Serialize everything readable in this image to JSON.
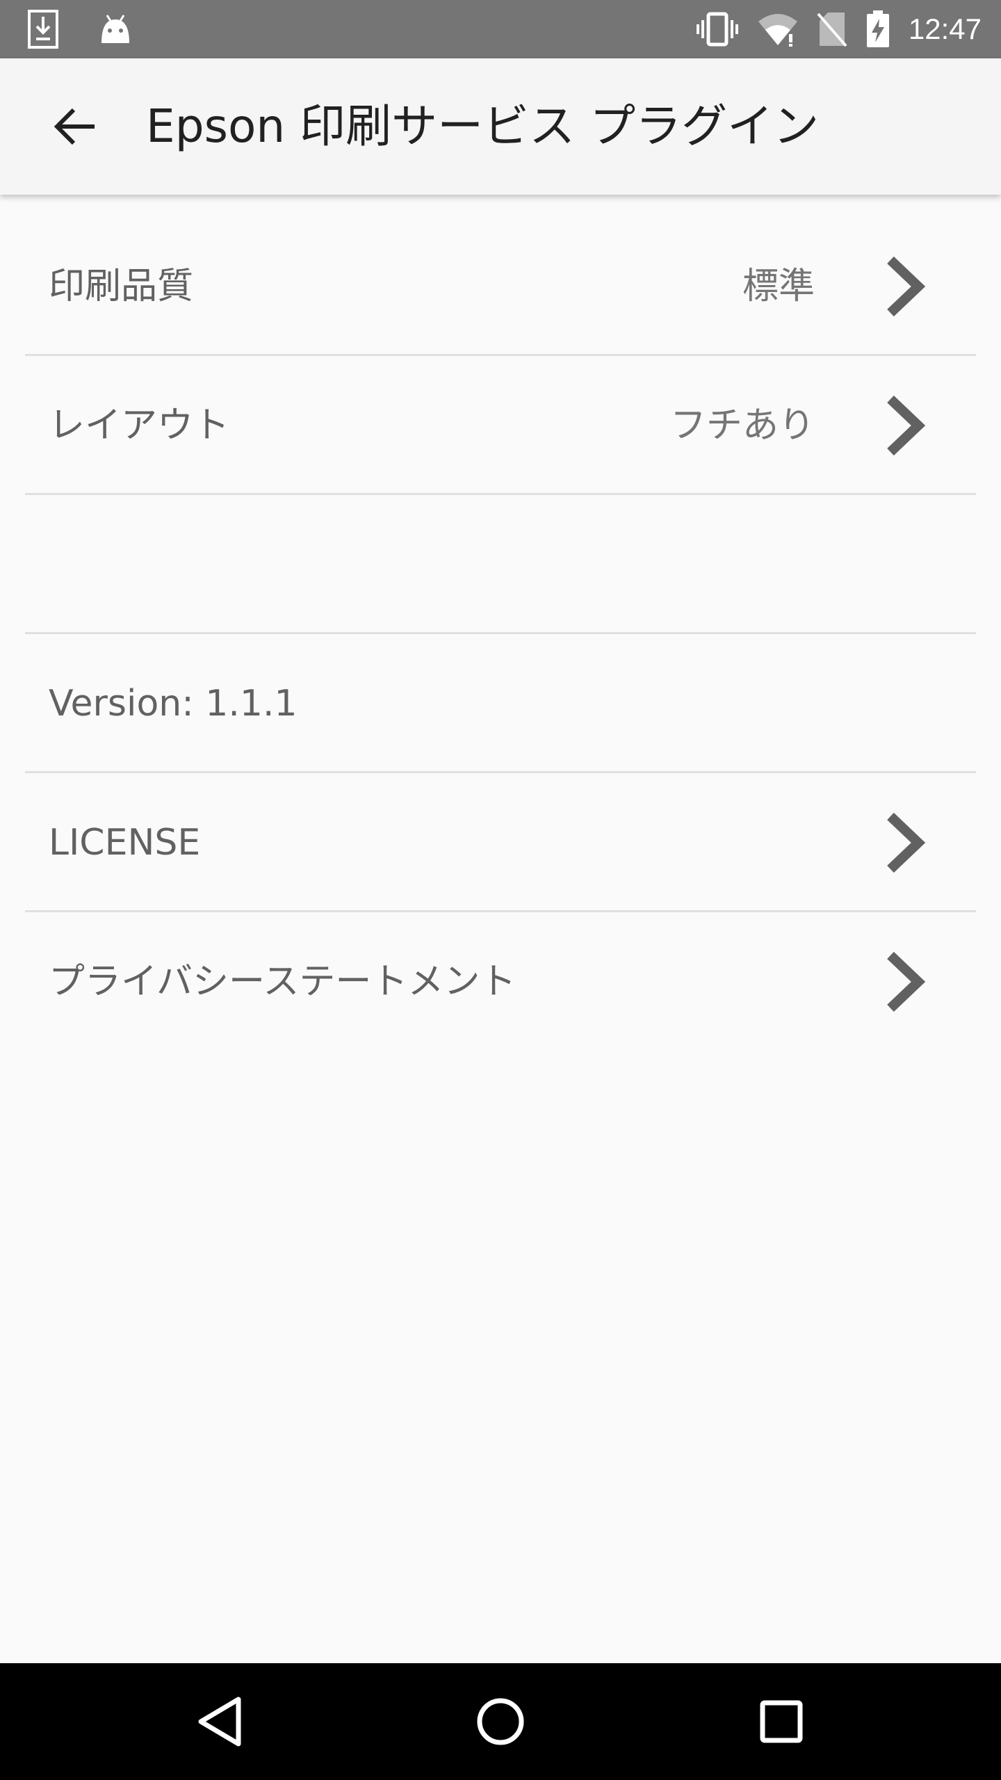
{
  "status_bar": {
    "time": "12:47",
    "icons": [
      "download-icon",
      "android-icon",
      "vibrate-icon",
      "wifi-icon",
      "no-sim-icon",
      "battery-charging-icon"
    ]
  },
  "app_bar": {
    "title": "Epson 印刷サービス プラグイン",
    "back_icon": "arrow-back-icon"
  },
  "settings": {
    "rows": [
      {
        "label": "印刷品質",
        "value": "標準",
        "chevron": true
      },
      {
        "label": "レイアウト",
        "value": "フチあり",
        "chevron": true
      },
      {
        "label": "",
        "value": "",
        "chevron": false
      },
      {
        "label": "Version: 1.1.1",
        "value": "",
        "chevron": false
      },
      {
        "label": "LICENSE",
        "value": "",
        "chevron": true
      },
      {
        "label": "プライバシーステートメント",
        "value": "",
        "chevron": true
      }
    ]
  },
  "nav_bar": {
    "icons": [
      "nav-back-icon",
      "nav-home-icon",
      "nav-recents-icon"
    ]
  },
  "colors": {
    "status_bar": "#757575",
    "app_bar": "#f5f5f5",
    "background": "#fafafa",
    "divider": "#e0e0e0",
    "chevron": "#616161",
    "nav_bar": "#000000"
  }
}
